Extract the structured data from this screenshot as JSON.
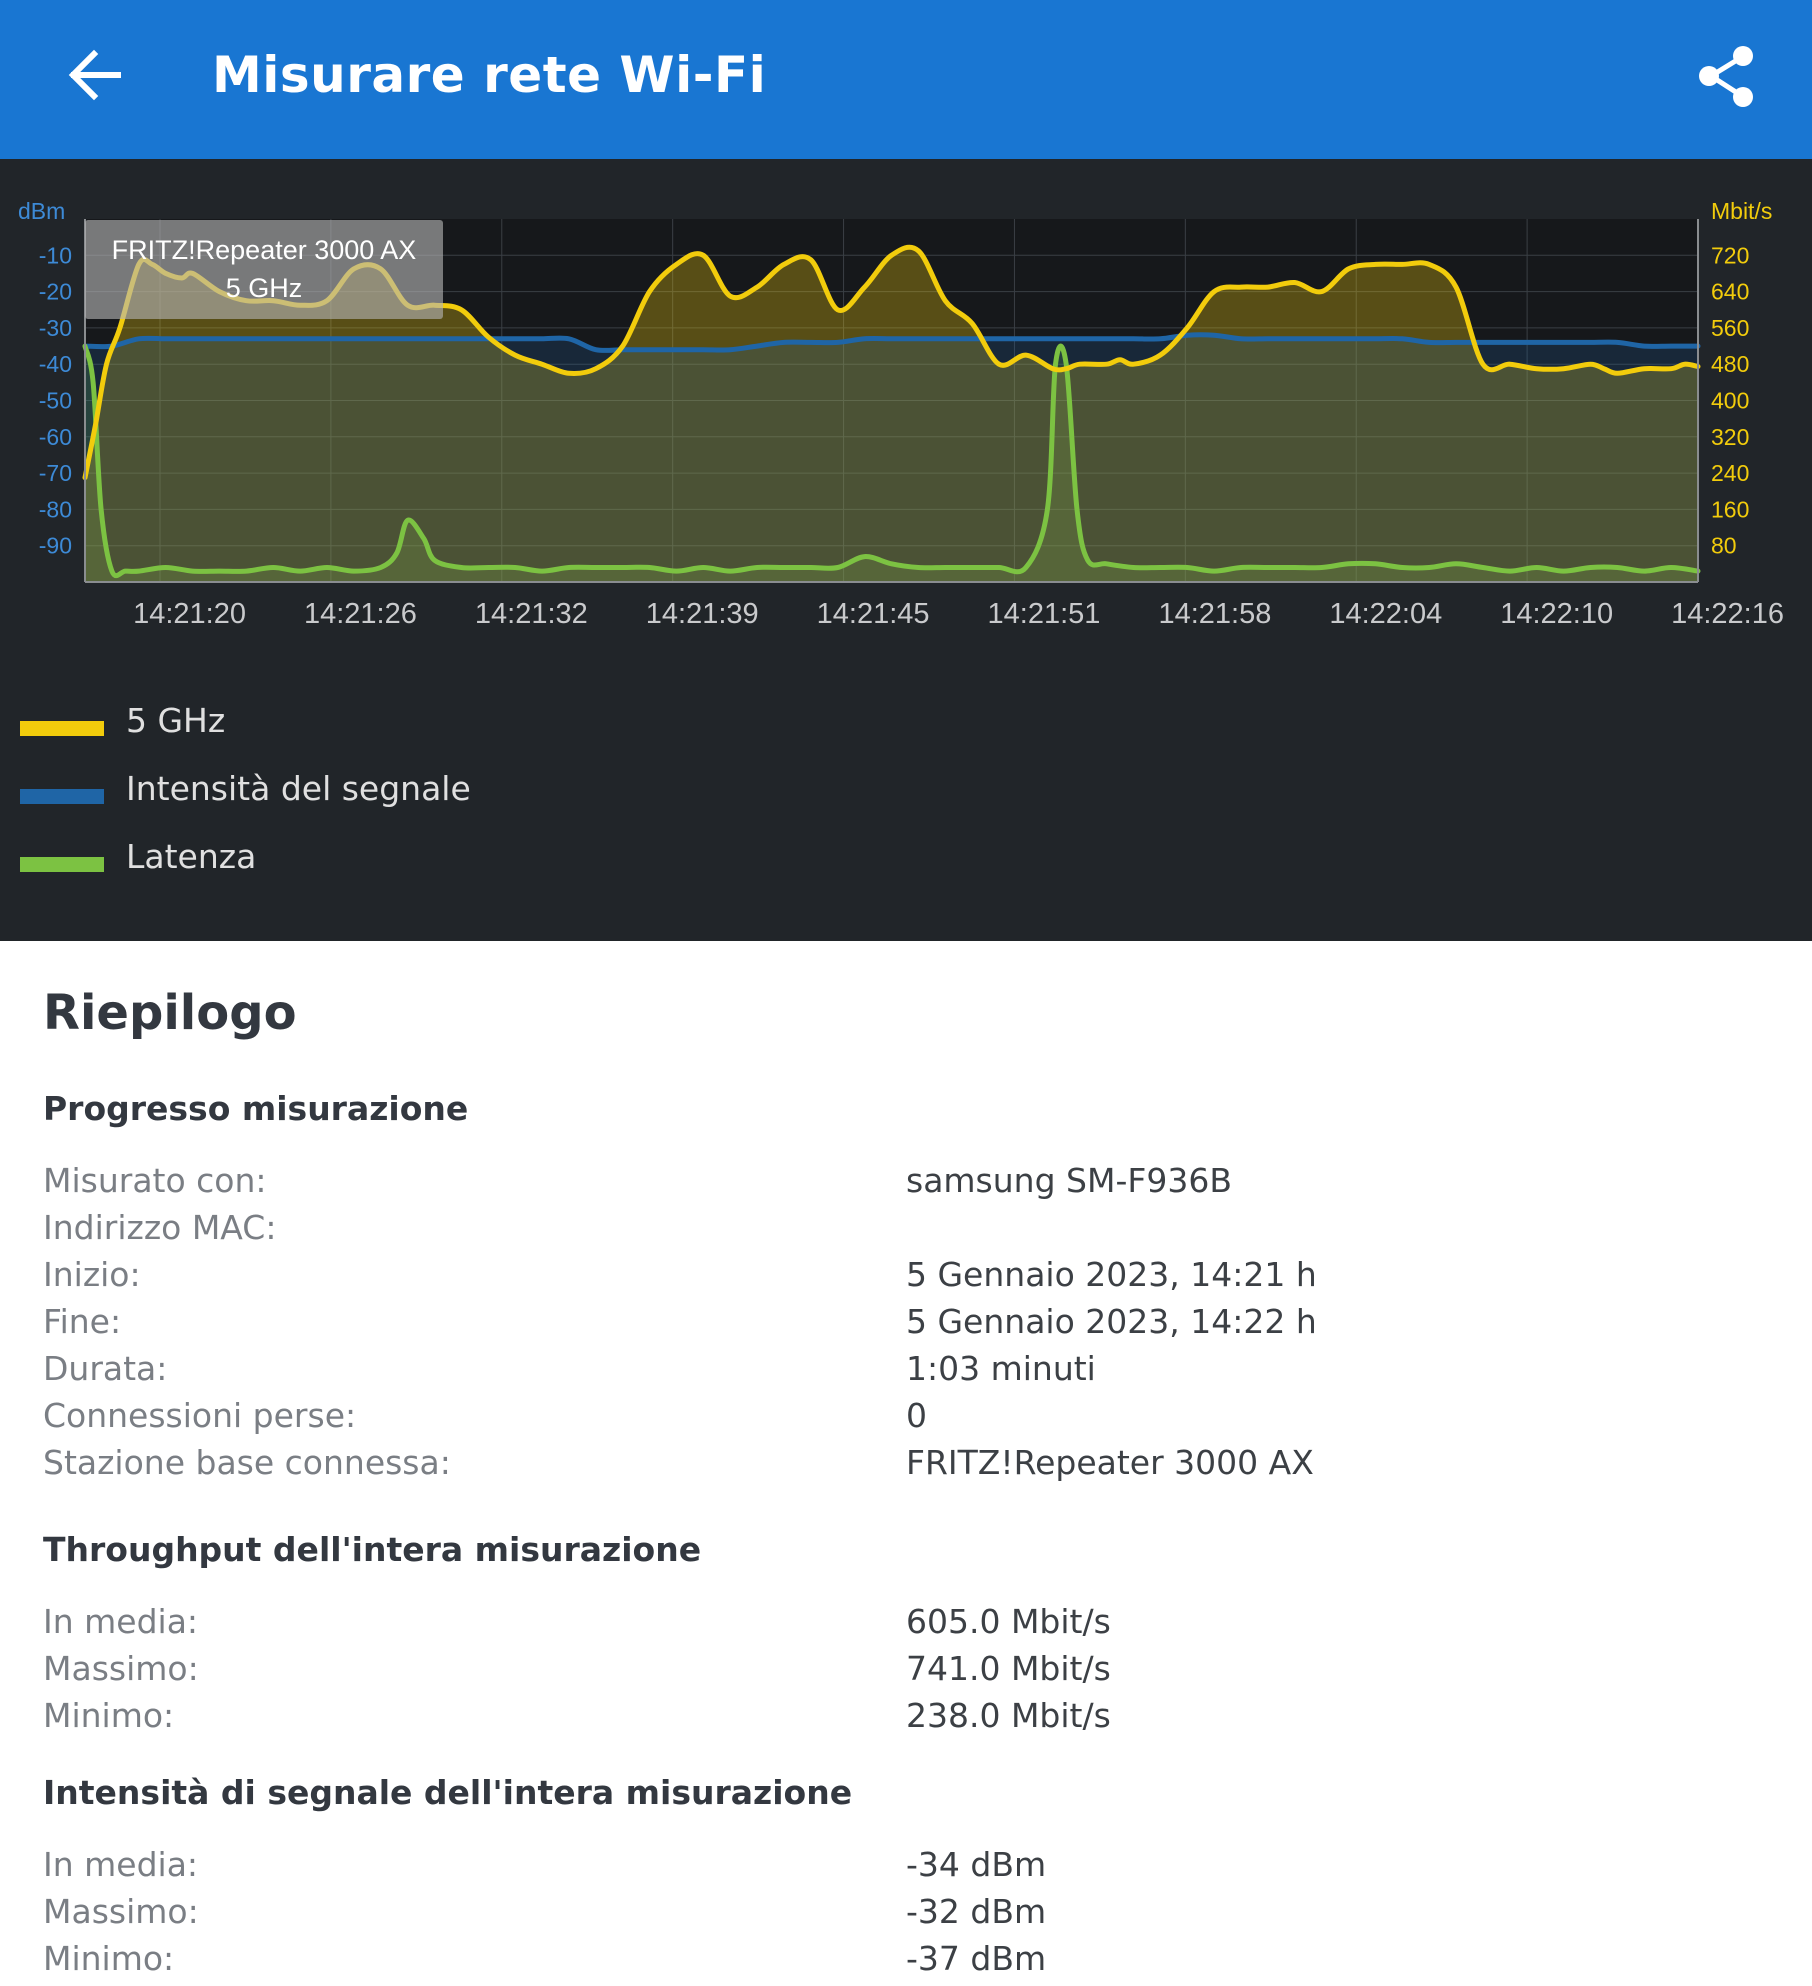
{
  "appbar": {
    "title": "Misurare rete Wi-Fi",
    "back_icon": "arrow-back-icon",
    "share_icon": "share-icon",
    "color": "#1976d2"
  },
  "chart_data": {
    "type": "line",
    "title": "",
    "left_unit": "dBm",
    "right_unit": "Mbit/s",
    "left_ticks": [
      "-10",
      "-20",
      "-30",
      "-40",
      "-50",
      "-60",
      "-70",
      "-80",
      "-90"
    ],
    "right_ticks": [
      "720",
      "640",
      "560",
      "480",
      "400",
      "320",
      "240",
      "160",
      "80"
    ],
    "x_ticks": [
      "14:21:20",
      "14:21:26",
      "14:21:32",
      "14:21:39",
      "14:21:45",
      "14:21:51",
      "14:21:58",
      "14:22:04",
      "14:22:10",
      "14:22:16"
    ],
    "left_ylim": [
      -100,
      0
    ],
    "right_ylim": [
      0,
      800
    ],
    "x_range_seconds": [
      0,
      60
    ],
    "x_tick_seconds": [
      6,
      12,
      18,
      24,
      30,
      36,
      42,
      48,
      54,
      60
    ],
    "grid": true,
    "legend_position": "bottom-left",
    "tooltip": {
      "line1": "FRITZ!Repeater 3000 AX",
      "line2": "5 GHz"
    },
    "series": [
      {
        "name": "5 GHz",
        "axis": "right",
        "color": "#f2cc0c",
        "x": [
          0,
          0.4,
          0.8,
          1.3,
          2,
          2.5,
          3,
          3.6,
          4,
          5,
          6,
          7,
          8,
          9,
          10,
          11,
          12,
          13,
          14,
          15,
          16,
          17,
          18,
          19,
          20,
          21,
          22,
          23,
          24,
          25,
          26,
          27,
          28,
          29,
          30,
          31,
          32,
          33,
          34,
          35,
          36,
          36.5,
          37,
          38,
          38.5,
          39,
          40,
          41,
          42,
          43,
          44,
          45,
          46,
          47,
          48,
          49,
          50,
          51,
          52,
          53,
          54,
          55,
          56,
          56.5,
          57,
          58,
          59,
          59.5,
          60
        ],
        "values": [
          230,
          350,
          480,
          560,
          700,
          700,
          680,
          670,
          680,
          640,
          620,
          620,
          610,
          620,
          690,
          690,
          610,
          610,
          600,
          540,
          500,
          480,
          460,
          470,
          520,
          640,
          700,
          720,
          630,
          650,
          700,
          710,
          600,
          650,
          720,
          730,
          620,
          570,
          480,
          500,
          470,
          470,
          480,
          480,
          490,
          480,
          500,
          560,
          640,
          650,
          650,
          660,
          640,
          690,
          700,
          700,
          700,
          650,
          480,
          480,
          470,
          470,
          480,
          470,
          460,
          470,
          470,
          480,
          475
        ]
      },
      {
        "name": "Intensità del segnale",
        "axis": "left",
        "color": "#1f65a6",
        "x": [
          0,
          1,
          2,
          3,
          4,
          5,
          6,
          7,
          8,
          9,
          10,
          11,
          12,
          13,
          14,
          15,
          16,
          17,
          18,
          19,
          20,
          21,
          22,
          23,
          24,
          25,
          26,
          27,
          28,
          29,
          30,
          31,
          32,
          33,
          34,
          35,
          36,
          37,
          38,
          39,
          40,
          41,
          42,
          43,
          44,
          45,
          46,
          47,
          48,
          49,
          50,
          51,
          52,
          53,
          54,
          55,
          56,
          57,
          58,
          59,
          60
        ],
        "values": [
          -35,
          -35,
          -33,
          -33,
          -33,
          -33,
          -33,
          -33,
          -33,
          -33,
          -33,
          -33,
          -33,
          -33,
          -33,
          -33,
          -33,
          -33,
          -33,
          -36,
          -36,
          -36,
          -36,
          -36,
          -36,
          -35,
          -34,
          -34,
          -34,
          -33,
          -33,
          -33,
          -33,
          -33,
          -33,
          -33,
          -33,
          -33,
          -33,
          -33,
          -33,
          -32,
          -32,
          -33,
          -33,
          -33,
          -33,
          -33,
          -33,
          -33,
          -34,
          -34,
          -34,
          -34,
          -34,
          -34,
          -34,
          -34,
          -35,
          -35,
          -35
        ]
      },
      {
        "name": "Latenza",
        "axis": "left",
        "color": "#7cc242",
        "x": [
          0,
          0.3,
          0.6,
          1,
          1.5,
          2,
          3,
          4,
          5,
          6,
          7,
          8,
          9,
          10,
          11,
          11.6,
          12,
          12.6,
          13,
          14,
          15,
          16,
          17,
          18,
          19,
          20,
          21,
          22,
          23,
          24,
          25,
          26,
          27,
          28,
          29,
          30,
          31,
          32,
          33,
          34,
          35,
          35.8,
          36.1,
          36.5,
          36.9,
          37.3,
          38,
          39,
          40,
          41,
          42,
          43,
          44,
          45,
          46,
          47,
          48,
          49,
          50,
          51,
          52,
          53,
          54,
          55,
          56,
          57,
          58,
          59,
          60
        ],
        "values": [
          -35,
          -45,
          -80,
          -97,
          -97,
          -97,
          -96,
          -97,
          -97,
          -97,
          -96,
          -97,
          -96,
          -97,
          -96,
          -92,
          -83,
          -88,
          -94,
          -96,
          -96,
          -96,
          -97,
          -96,
          -96,
          -96,
          -96,
          -97,
          -96,
          -97,
          -96,
          -96,
          -96,
          -96,
          -93,
          -95,
          -96,
          -96,
          -96,
          -96,
          -96,
          -80,
          -40,
          -40,
          -80,
          -94,
          -95,
          -96,
          -96,
          -96,
          -97,
          -96,
          -96,
          -96,
          -96,
          -95,
          -95,
          -96,
          -96,
          -95,
          -96,
          -97,
          -96,
          -97,
          -96,
          -96,
          -97,
          -96,
          -97
        ]
      }
    ]
  },
  "legend": [
    {
      "label": "5 GHz",
      "color": "#f2cc0c"
    },
    {
      "label": "Intensità del segnale",
      "color": "#1f65a6"
    },
    {
      "label": "Latenza",
      "color": "#7cc242"
    }
  ],
  "summary": {
    "title": "Riepilogo",
    "progress": {
      "title": "Progresso misurazione",
      "rows": [
        {
          "label": "Misurato con:",
          "value": "samsung SM-F936B"
        },
        {
          "label": "Indirizzo MAC:",
          "value": ""
        },
        {
          "label": "Inizio:",
          "value": "5 Gennaio 2023, 14:21 h"
        },
        {
          "label": "Fine:",
          "value": "5 Gennaio 2023, 14:22 h"
        },
        {
          "label": "Durata:",
          "value": "1:03 minuti"
        },
        {
          "label": "Connessioni perse:",
          "value": "0"
        },
        {
          "label": "Stazione base connessa:",
          "value": "FRITZ!Repeater 3000 AX"
        }
      ]
    },
    "throughput": {
      "title": "Throughput dell'intera misurazione",
      "rows": [
        {
          "label": "In media:",
          "value": "605.0 Mbit/s"
        },
        {
          "label": "Massimo:",
          "value": "741.0 Mbit/s"
        },
        {
          "label": "Minimo:",
          "value": "238.0 Mbit/s"
        }
      ]
    },
    "signal": {
      "title": "Intensità di segnale dell'intera misurazione",
      "rows": [
        {
          "label": "In media:",
          "value": "-34 dBm"
        },
        {
          "label": "Massimo:",
          "value": "-32 dBm"
        },
        {
          "label": "Minimo:",
          "value": "-37 dBm"
        }
      ]
    }
  }
}
